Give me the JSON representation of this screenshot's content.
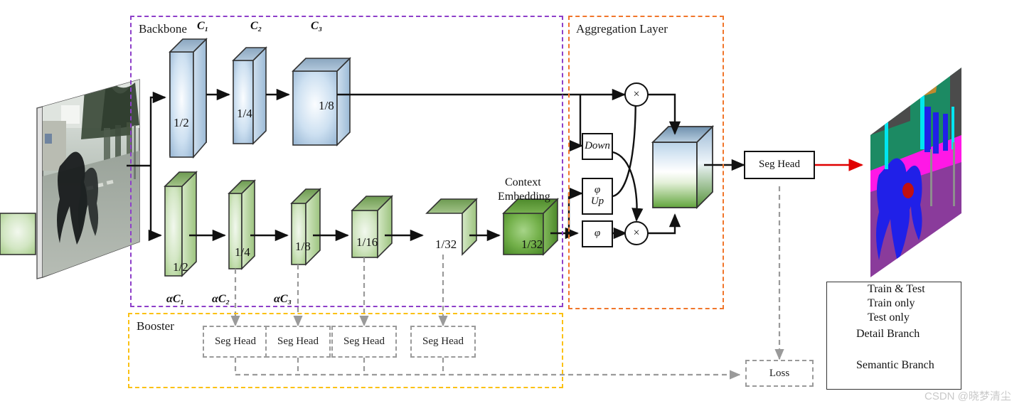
{
  "figure": {
    "type": "architecture-diagram",
    "watermark": "CSDN @晓梦清尘"
  },
  "regions": [
    {
      "id": "backbone",
      "label": "Backbone",
      "color": "#8e3fc9"
    },
    {
      "id": "aggregation",
      "label": "Aggregation Layer",
      "color": "#f1762b"
    },
    {
      "id": "booster",
      "label": "Booster",
      "color": "#fbc114"
    }
  ],
  "detail_branch": {
    "name": "Detail Branch",
    "channel_labels": [
      "C₁",
      "C₂",
      "C₃"
    ],
    "blocks": [
      {
        "scale": "1/2",
        "channel": "C₁"
      },
      {
        "scale": "1/4",
        "channel": "C₂"
      },
      {
        "scale": "1/8",
        "channel": "C₃"
      }
    ]
  },
  "semantic_branch": {
    "name": "Semantic Branch",
    "channel_labels": [
      "αC₁",
      "αC₂",
      "αC₃"
    ],
    "blocks": [
      {
        "scale": "1/2"
      },
      {
        "scale": "1/4"
      },
      {
        "scale": "1/8"
      },
      {
        "scale": "1/16"
      },
      {
        "scale": "1/32"
      },
      {
        "scale": "1/32"
      }
    ],
    "context_embedding_label": [
      "Context",
      "Embedding"
    ]
  },
  "aggregation": {
    "title": "Aggregation Layer",
    "ops": [
      {
        "id": "down",
        "label": "Down"
      },
      {
        "id": "phiup",
        "label": "φ\nUp",
        "line1": "φ",
        "line2": "Up"
      },
      {
        "id": "phi",
        "label": "φ"
      }
    ],
    "multiply_symbol": "×",
    "fused_block_desc": "fused detail+semantic feature cube"
  },
  "seg_head": {
    "main_label": "Seg Head",
    "booster_labels": [
      "Seg Head",
      "Seg Head",
      "Seg Head",
      "Seg Head"
    ]
  },
  "loss": {
    "label": "Loss"
  },
  "legend": {
    "entries": [
      {
        "kind": "arrow-solid-black",
        "label": "Train & Test",
        "color": "#111111"
      },
      {
        "kind": "arrow-dotted-gray",
        "label": "Train only",
        "color": "#9a9a9a"
      },
      {
        "kind": "arrow-solid-red",
        "label": "Test only",
        "color": "#e00000"
      },
      {
        "kind": "swatch-blue",
        "label": "Detail Branch",
        "color": "#b6cfe6"
      },
      {
        "kind": "swatch-green",
        "label": "Semantic Branch",
        "color": "#bedcae"
      }
    ]
  },
  "colors": {
    "detail_block_face": "#c9dcef",
    "detail_block_top": "#7f9ab4",
    "semantic_block_face": "#cfe3bf",
    "semantic_block_top": "#7fa566",
    "context_block_face": "#6fab44",
    "arrow_black": "#111111",
    "arrow_red": "#e00000",
    "arrow_gray": "#9a9a9a",
    "backbone_border": "#8e3fc9",
    "aggregation_border": "#f1762b",
    "booster_border": "#fbc114"
  },
  "images": {
    "input": {
      "alt": "input street scene photograph"
    },
    "output": {
      "alt": "semantic segmentation color map output"
    }
  }
}
